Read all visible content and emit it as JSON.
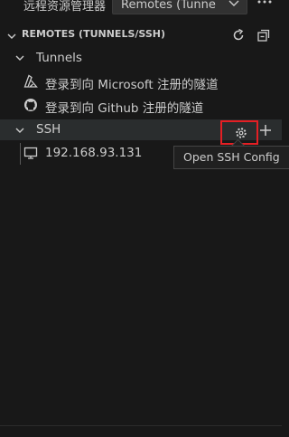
{
  "toolbar": {
    "view_title": "远程资源管理器",
    "remote_select_value": "Remotes (Tunne",
    "more_icon": "ellipsis-icon"
  },
  "section": {
    "title": "REMOTES (TUNNELS/SSH)",
    "refresh_icon": "refresh-icon",
    "collapse_icon": "collapse-all-icon"
  },
  "tunnels": {
    "label": "Tunnels",
    "items": [
      {
        "label": "登录到向 Microsoft 注册的隧道",
        "icon": "azure-icon"
      },
      {
        "label": "登录到向 Github 注册的隧道",
        "icon": "github-icon"
      }
    ]
  },
  "ssh": {
    "label": "SSH",
    "config_icon": "gear-icon",
    "add_icon": "plus-icon",
    "hosts": [
      {
        "label": "192.168.93.131",
        "icon": "monitor-icon"
      }
    ]
  },
  "tooltip": {
    "text": "Open SSH Config"
  },
  "colors": {
    "background": "#181818",
    "text": "#cccccc",
    "highlight": "#e51f24"
  }
}
